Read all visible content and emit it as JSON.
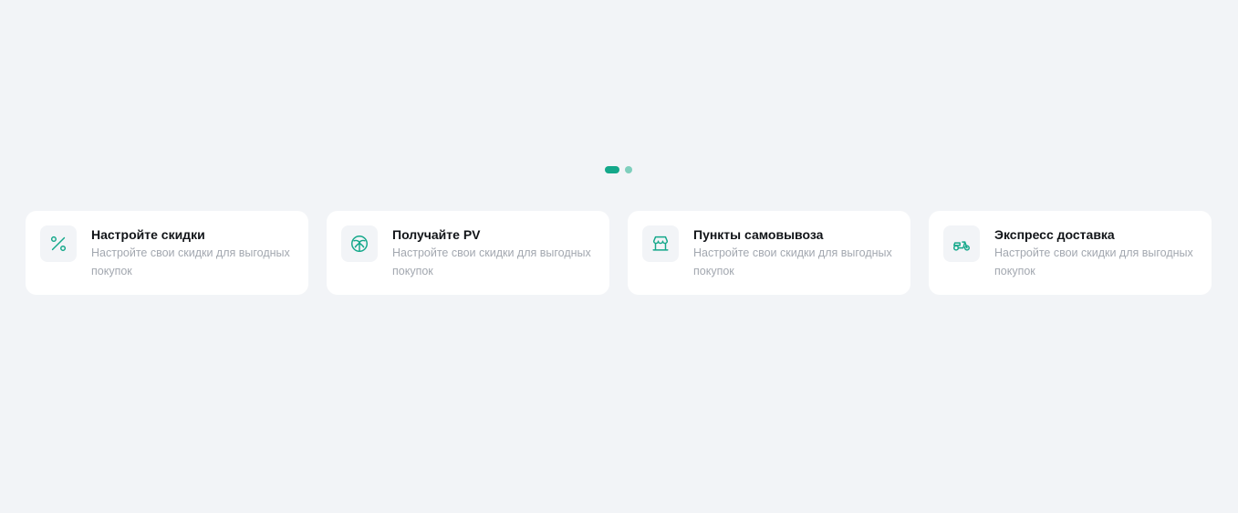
{
  "carousel": {
    "dot_count": 2,
    "active_index": 0,
    "colors": {
      "active": "#14a88a",
      "inactive": "#7fcfbd"
    }
  },
  "cards": [
    {
      "icon": "percent-icon",
      "title": "Настройте скидки",
      "description": "Настройте свои скидки для выгодных покупок"
    },
    {
      "icon": "leaf-ball-icon",
      "title": "Получайте PV",
      "description": "Настройте свои скидки для выгодных покупок"
    },
    {
      "icon": "storefront-icon",
      "title": "Пункты самовывоза",
      "description": "Настройте свои скидки для выгодных покупок"
    },
    {
      "icon": "scooter-icon",
      "title": "Экспресс доставка",
      "description": "Настройте свои скидки для выгодных покупок"
    }
  ],
  "accent_color": "#14a88a"
}
